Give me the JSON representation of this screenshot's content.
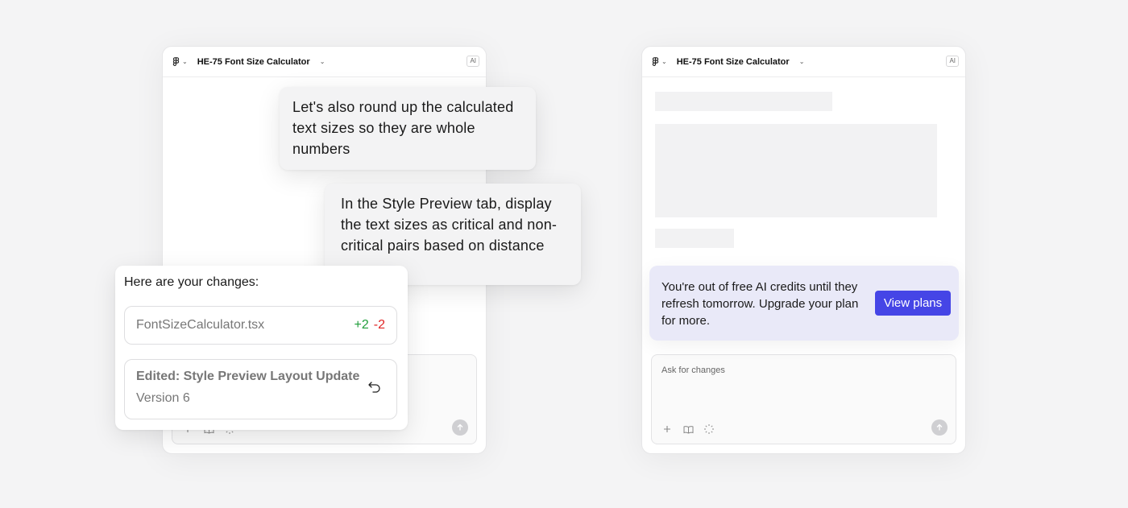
{
  "left_window": {
    "app_title": "HE-75 Font Size Calculator",
    "ai_badge": "AI"
  },
  "right_window": {
    "app_title": "HE-75 Font Size Calculator",
    "ai_badge": "AI",
    "composer_placeholder": "Ask for changes"
  },
  "prompts": [
    {
      "text": "Let's also round up the calculated text sizes so they are whole numbers"
    },
    {
      "text": "In the Style Preview tab, display the text sizes as critical and non-critical pairs based on distance"
    }
  ],
  "changes": {
    "heading": "Here are your changes:",
    "file_name": "FontSizeCalculator.tsx",
    "additions": "+2",
    "deletions": "-2",
    "version_title": "Edited: Style Preview Layout Update",
    "version_label": "Version 6"
  },
  "credits_banner": {
    "message": "You're out of free AI credits until they refresh tomorrow. Upgrade your plan for more.",
    "button_label": "View plans"
  },
  "colors": {
    "accent": "#4545e6",
    "additions": "#1f9d3a",
    "deletions": "#e02424",
    "banner_bg": "#e9e9f8"
  },
  "icons": {
    "app_menu": "figma-logo-icon",
    "add": "plus-icon",
    "library": "book-icon",
    "select": "cursor-sparkle-icon",
    "send": "arrow-up-icon",
    "undo": "undo-icon"
  }
}
